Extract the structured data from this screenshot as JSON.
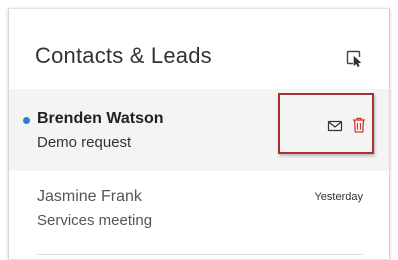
{
  "header": {
    "title": "Contacts & Leads",
    "select_icon": "pointer-select-icon"
  },
  "contacts": [
    {
      "name": "Brenden Watson",
      "subject": "Demo request",
      "unread": true,
      "selected": true,
      "actions": {
        "mail_icon": "mail-icon",
        "delete_icon": "trash-icon"
      }
    },
    {
      "name": "Jasmine Frank",
      "subject": "Services meeting",
      "time": "Yesterday",
      "unread": false,
      "selected": false
    }
  ],
  "colors": {
    "unread_dot": "#2f7ad6",
    "delete_icon": "#d9342b",
    "highlight_border": "#a83232",
    "selected_row_bg": "#f4f4f4"
  }
}
